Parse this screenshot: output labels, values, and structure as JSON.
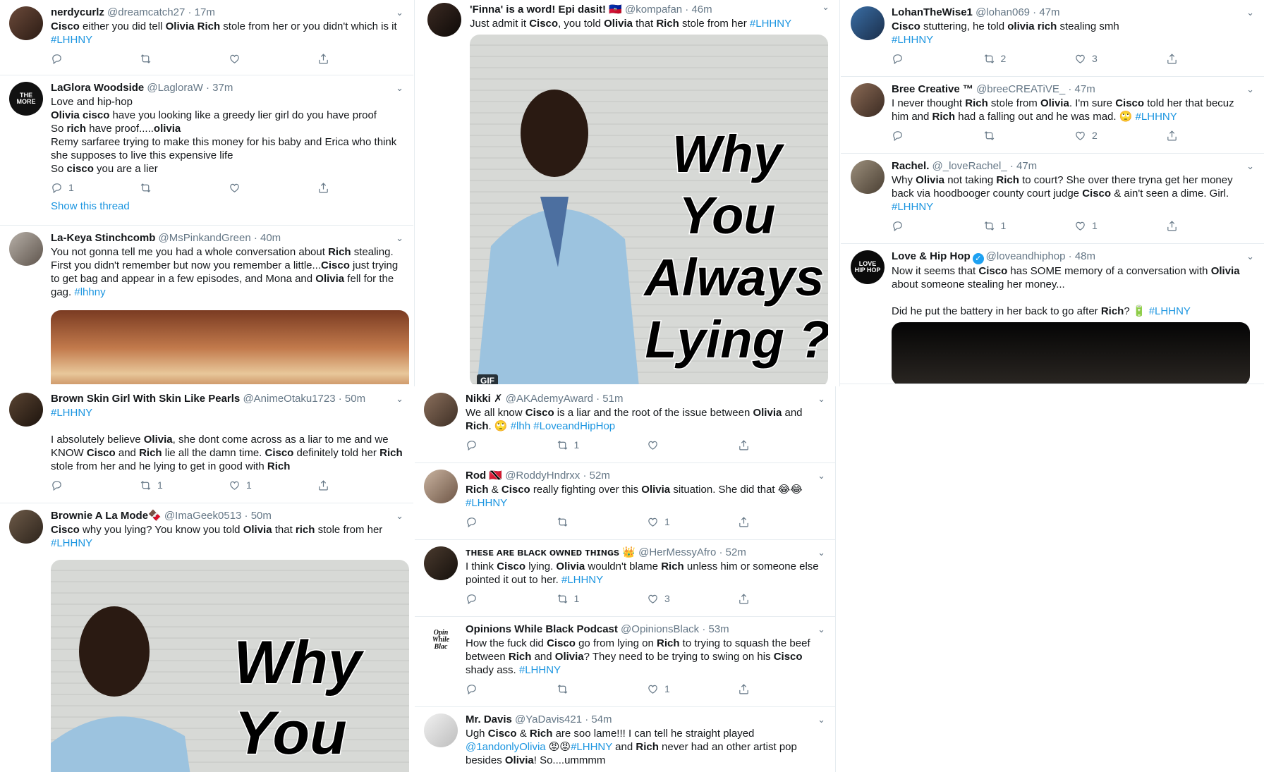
{
  "labels": {
    "show_thread": "Show this thread",
    "gif": "GIF"
  },
  "meme": {
    "line1": "Why",
    "line2": "You",
    "line3": "Always",
    "line4": "Lying ?"
  },
  "colors": {
    "link": "#1b95e0",
    "meta": "#657786",
    "divider": "#e6ecf0"
  },
  "tweets": {
    "t1": {
      "name": "nerdycurlz",
      "meta": "@dreamcatch27 · 17m",
      "reply": "",
      "retweet": "",
      "like": "",
      "l1a": "Cisco",
      "l1b": " either you did tell ",
      "l1c": "Olivia Rich",
      "l1d": " stole from her or you didn't which is it",
      "l2": "#LHHNY"
    },
    "t2": {
      "name": "LaGlora Woodside",
      "meta": "@LagloraW · 37m",
      "reply": "1",
      "retweet": "",
      "like": "",
      "l1": "Love and hip-hop",
      "l2a": "Olivia cisco",
      "l2b": " have you looking like a greedy lier girl do you have proof",
      "l3a": "So ",
      "l3b": "rich",
      "l3c": " have proof.....",
      "l3d": "olivia",
      "l4": "Remy sarfaree trying to make this money for his baby and Erica who think",
      "l5": "she supposes to live this expensive life",
      "l6a": "So ",
      "l6b": "cisco",
      "l6c": " you are a lier"
    },
    "t3": {
      "name": "La-Keya Stinchcomb",
      "meta": "@MsPinkandGreen · 40m",
      "l1a": "You not gonna tell me you had a whole conversation about ",
      "l1b": "Rich",
      "l1c": " stealing.",
      "l2a": "First you didn't remember but now you remember a little...",
      "l2b": "Cisco",
      "l2c": " just trying",
      "l3a": "to get bag and appear in a few episodes, and Mona and ",
      "l3b": "Olivia",
      "l3c": " fell for the",
      "l4a": "gag. ",
      "l4b": "#lhhny"
    },
    "t4": {
      "name": "Brown Skin Girl With Skin Like Pearls",
      "meta": "@AnimeOtaku1723 · 50m",
      "reply": "",
      "retweet": "1",
      "like": "1",
      "l1": "#LHHNY",
      "l2a": "I absolutely believe ",
      "l2b": "Olivia",
      "l2c": ", she dont come across as a liar to me and we",
      "l3a": "KNOW ",
      "l3b": "Cisco",
      "l3c": " and ",
      "l3d": "Rich",
      "l3e": " lie all the damn time. ",
      "l3f": "Cisco",
      "l3g": " definitely told her ",
      "l3h": "Rich",
      "l4a": " stole from her and he lying to get in good with ",
      "l4b": "Rich"
    },
    "t5": {
      "name": "Brownie A La Mode",
      "emoji": "🍫",
      "meta": "@ImaGeek0513 · 50m",
      "l1a": "Cisco",
      "l1b": " why you lying? You know you told ",
      "l1c": "Olivia",
      "l1d": " that ",
      "l1e": "rich",
      "l1f": " stole from her",
      "l2": "#LHHNY"
    },
    "t6": {
      "name": "'Finna' is a word! Epi dasit!",
      "emoji": "🇭🇹",
      "meta": "@kompafan · 46m",
      "l1a": "Just admit it ",
      "l1b": "Cisco",
      "l1c": ", you told ",
      "l1d": "Olivia",
      "l1e": " that ",
      "l1f": "Rich",
      "l1g": " stole from her  ",
      "l1h": "#LHHNY"
    },
    "t7": {
      "name": "Nikki",
      "emoji": "✗",
      "meta": "@AKAdemyAward · 51m",
      "reply": "",
      "retweet": "1",
      "like": "",
      "l1a": "We all know ",
      "l1b": "Cisco",
      "l1c": " is a liar and the root of the issue between ",
      "l1d": "Olivia",
      "l1e": " and",
      "l2a": "Rich",
      "l2b": ". 🙄 ",
      "l2c": "#lhh #LoveandHipHop"
    },
    "t8": {
      "name": "Rod",
      "emoji": "🇹🇹",
      "meta": "@RoddyHndrxx · 52m",
      "reply": "",
      "retweet": "",
      "like": "1",
      "l1a": "Rich",
      "l1b": " & ",
      "l1c": "Cisco",
      "l1d": " really fighting over this ",
      "l1e": "Olivia",
      "l1f": " situation. She did that 😂😂",
      "l2": "#LHHNY"
    },
    "t9": {
      "name": "ᴛʜᴇsᴇ ᴀʀᴇ ʙʟᴀᴄᴋ ᴏᴡɴᴇᴅ ᴛʜɪɴɢs",
      "emoji": "👑",
      "meta": "@HerMessyAfro · 52m",
      "reply": "",
      "retweet": "1",
      "like": "3",
      "l1a": "I think ",
      "l1b": "Cisco",
      "l1c": " lying. ",
      "l1d": "Olivia",
      "l1e": " wouldn't blame ",
      "l1f": "Rich",
      "l1g": " unless him or someone else",
      "l2a": "pointed it out to her. ",
      "l2b": "#LHHNY"
    },
    "t10": {
      "name": "Opinions While Black Podcast",
      "meta": "@OpinionsBlack · 53m",
      "reply": "",
      "retweet": "",
      "like": "1",
      "l1a": "How the fuck did ",
      "l1b": "Cisco",
      "l1c": " go from lying on ",
      "l1d": "Rich",
      "l1e": " to trying to squash the beef",
      "l2a": "between ",
      "l2b": "Rich",
      "l2c": " and ",
      "l2d": "Olivia",
      "l2e": "? They need to be trying to swing on his ",
      "l2f": "Cisco",
      "l3a": " shady ass. ",
      "l3b": "#LHHNY"
    },
    "t11": {
      "name": "Mr. Davis",
      "meta": "@YaDavis421 · 54m",
      "l1a": "Ugh ",
      "l1b": "Cisco",
      "l1c": " & ",
      "l1d": "Rich",
      "l1e": " are soo lame!!! I can tell he straight played",
      "l2a": "@1andonlyOlivia",
      "l2b": " 😡😡",
      "l2c": "#LHHNY",
      "l2d": " and ",
      "l2e": "Rich",
      "l2f": " never had an other artist pop",
      "l3a": "besides ",
      "l3b": "Olivia",
      "l3c": "! So....ummmm"
    },
    "t12": {
      "name": "LohanTheWise1",
      "meta": "@lohan069 · 47m",
      "reply": "",
      "retweet": "2",
      "like": "3",
      "l1a": "Cisco",
      "l1b": " stuttering, he told ",
      "l1c": "olivia rich",
      "l1d": " stealing smh",
      "l2": "#LHHNY"
    },
    "t13": {
      "name": "Bree Creative ™",
      "meta": "@breeCREATiVE_ · 47m",
      "reply": "",
      "retweet": "",
      "like": "2",
      "l1a": "I never thought ",
      "l1b": "Rich",
      "l1c": " stole from ",
      "l1d": "Olivia",
      "l1e": ". I'm sure ",
      "l1f": "Cisco",
      "l1g": " told her that becuz",
      "l2a": "him and ",
      "l2b": "Rich",
      "l2c": " had a falling out and he was mad. 🙄 ",
      "l2d": "#LHHNY"
    },
    "t14": {
      "name": "Rachel.",
      "meta": "@_loveRachel_ · 47m",
      "reply": "",
      "retweet": "1",
      "like": "1",
      "l1a": "Why ",
      "l1b": "Olivia",
      "l1c": " not taking ",
      "l1d": "Rich",
      "l1e": " to court? She over there tryna get her money",
      "l2a": "back via hoodbooger county court judge ",
      "l2b": "Cisco",
      "l2c": " & ain't seen a dime. Girl.",
      "l3": "#LHHNY"
    },
    "t15": {
      "name": "Love & Hip Hop",
      "meta": "@loveandhiphop · 48m",
      "l1a": "Now it seems that ",
      "l1b": "Cisco",
      "l1c": " has SOME memory of a conversation with ",
      "l1d": "Olivia",
      "l2": " about someone stealing her money...",
      "l3a": "Did he put the battery in her back to go after ",
      "l3b": "Rich",
      "l3c": "? 🔋 ",
      "l3d": "#LHHNY"
    }
  }
}
